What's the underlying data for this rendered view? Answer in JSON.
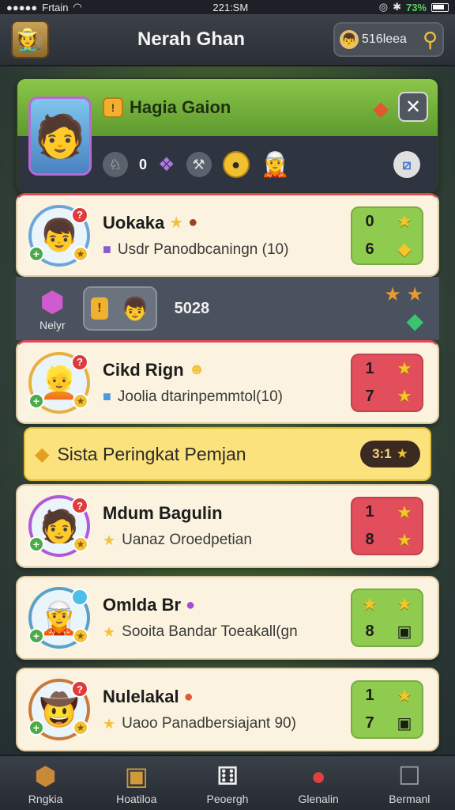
{
  "status": {
    "carrier": "Frtain",
    "time": "221:SM",
    "battery_pct": "73%"
  },
  "header": {
    "title": "Nerah Ghan",
    "search_text": "516leea",
    "avatar_icon": "adventurer-avatar-icon"
  },
  "profile": {
    "name": "Hagia Gaion",
    "badge": "!",
    "stats": [
      {
        "icon": "helmet-icon",
        "value": "0"
      }
    ],
    "close_label": "✕"
  },
  "strip": {
    "label": "Nelyr",
    "value": "5028"
  },
  "banner": {
    "text": "Sista Peringkat Pemjan",
    "badge_value": "3:1"
  },
  "players": [
    {
      "name": "Uokaka",
      "sub": "Usdr Panodbcaningn (10)",
      "score_color": "green",
      "score": [
        "0",
        "★",
        "6",
        "◆"
      ]
    },
    {
      "name": "Cikd Rign",
      "sub": "Joolia dtarinpemmtol(10)",
      "score_color": "red",
      "score": [
        "1",
        "★",
        "7",
        "★"
      ]
    },
    {
      "name": "Mdum Bagulin",
      "sub": "Uanaz Oroedpetian",
      "score_color": "red",
      "score": [
        "1",
        "★",
        "8",
        "★"
      ]
    },
    {
      "name": "Omlda Br",
      "sub": "Sooita Bandar Toeakall(gn",
      "score_color": "green",
      "score": [
        "★",
        "★",
        "8",
        "▣"
      ]
    },
    {
      "name": "Nulelakal",
      "sub": "Uaoo Panadbersiajant 90)",
      "score_color": "green",
      "score": [
        "1",
        "★",
        "7",
        "▣"
      ]
    }
  ],
  "nav": [
    {
      "label": "Rngkia",
      "icon": "cube-icon"
    },
    {
      "label": "Hoatiloa",
      "icon": "chest-icon"
    },
    {
      "label": "Peoergh",
      "icon": "dice-icon"
    },
    {
      "label": "Glenalin",
      "icon": "potion-icon"
    },
    {
      "label": "Bermanl",
      "icon": "robot-icon"
    }
  ]
}
